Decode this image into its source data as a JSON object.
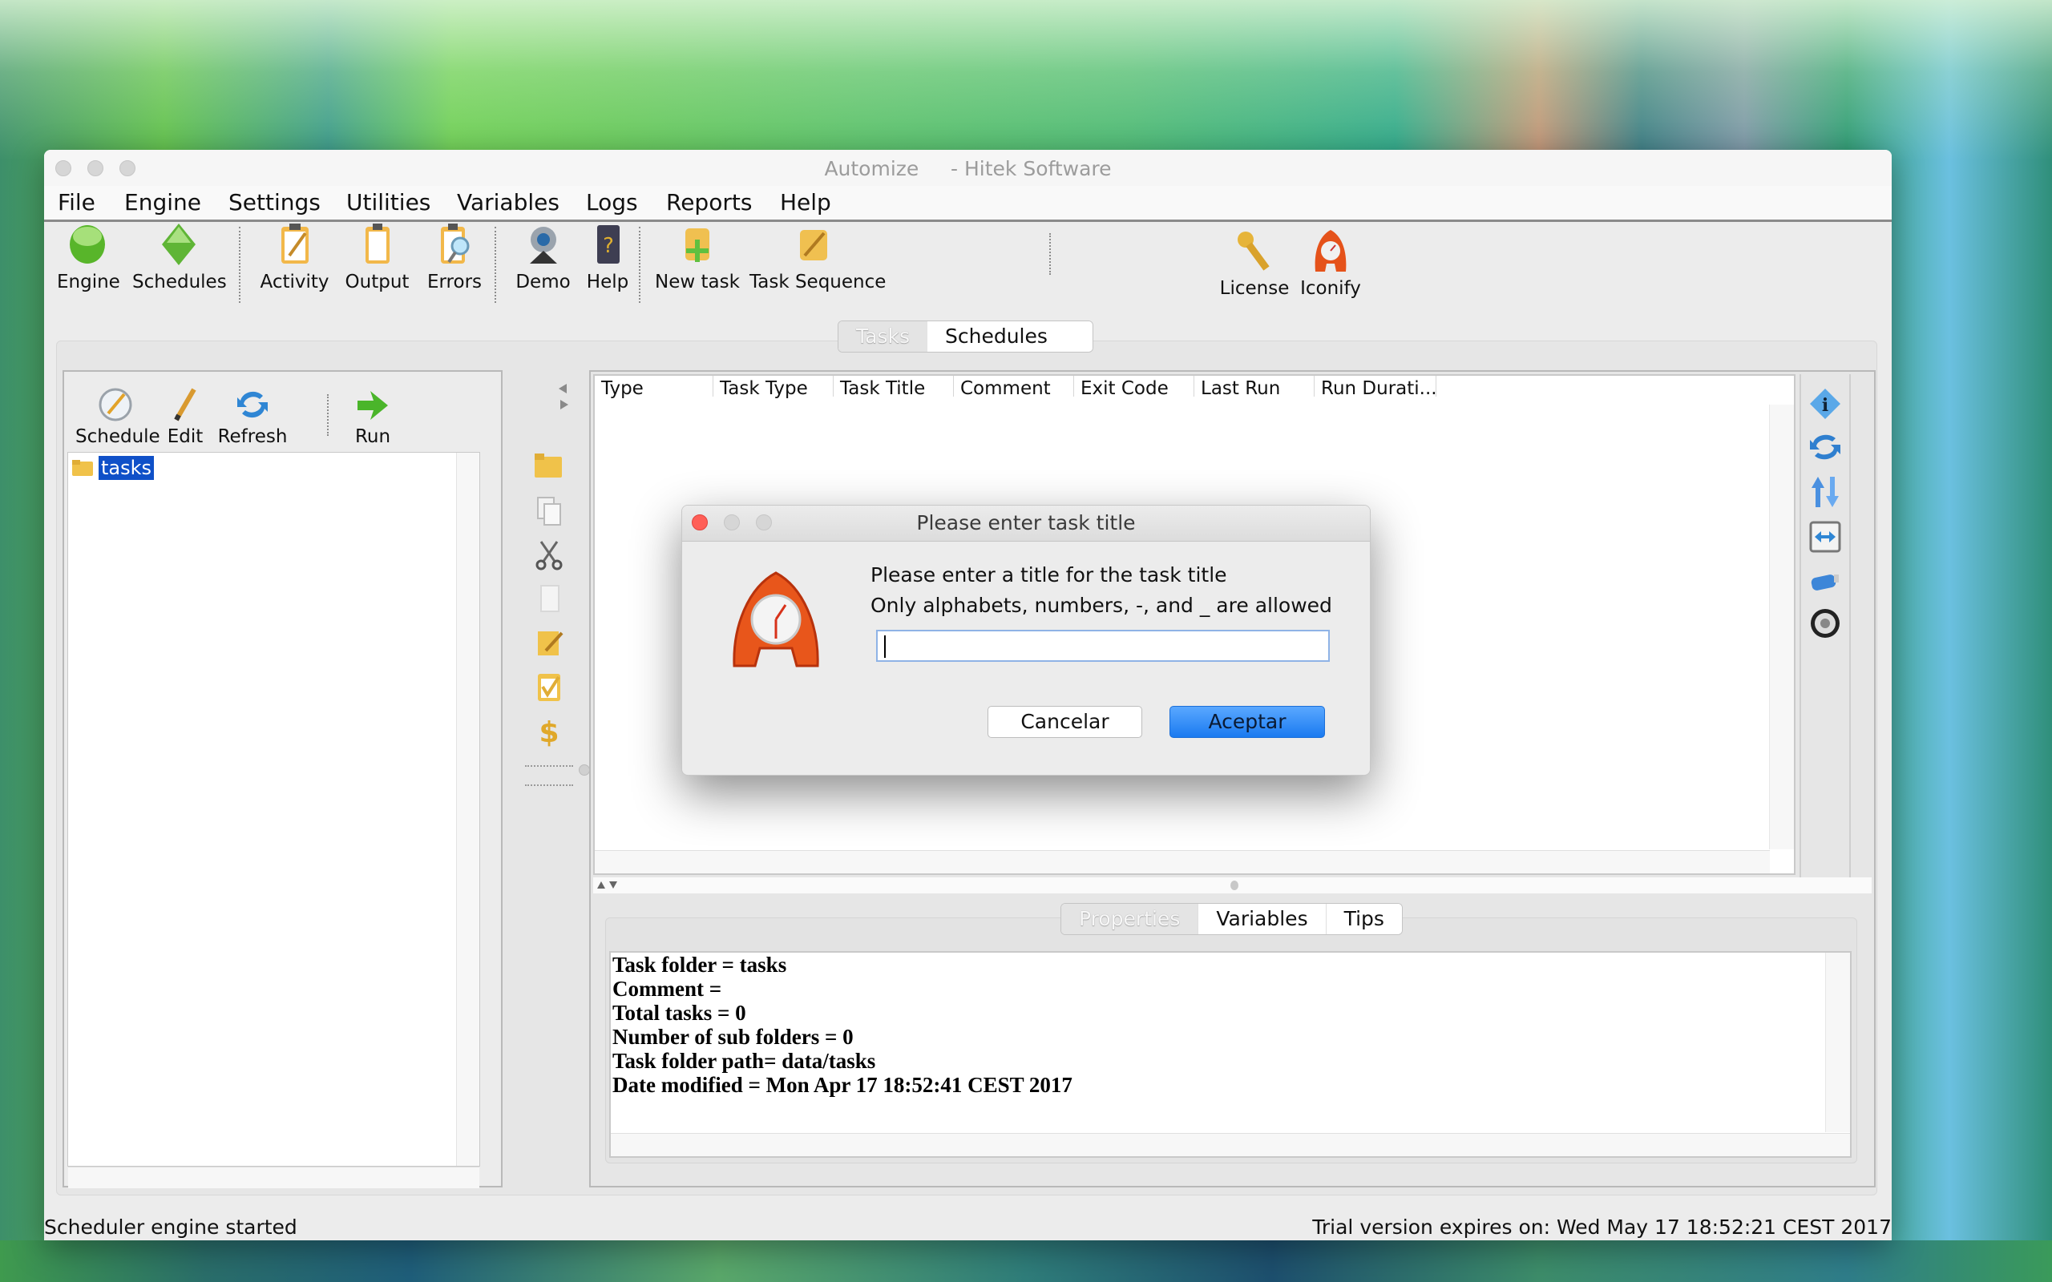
{
  "window": {
    "title": "Automize     - Hitek Software",
    "menu": [
      "File",
      "Engine",
      "Settings",
      "Utilities",
      "Variables",
      "Logs",
      "Reports",
      "Help"
    ],
    "toolbar": [
      {
        "label": "Engine",
        "icon": "engine-green-oval-icon"
      },
      {
        "label": "Schedules",
        "icon": "schedules-green-diamond-icon"
      },
      {
        "label": "Activity",
        "icon": "activity-clipboard-icon"
      },
      {
        "label": "Output",
        "icon": "output-clipboard-icon"
      },
      {
        "label": "Errors",
        "icon": "errors-magnifier-icon"
      },
      {
        "label": "Demo",
        "icon": "webcam-icon"
      },
      {
        "label": "Help",
        "icon": "help-book-icon"
      },
      {
        "label": "New task",
        "icon": "new-task-scroll-icon"
      },
      {
        "label": "Task Sequence",
        "icon": "task-sequence-scroll-icon"
      },
      {
        "label": "License",
        "icon": "key-icon"
      },
      {
        "label": "Iconify",
        "icon": "alarm-clock-icon"
      }
    ],
    "main_tabs": [
      {
        "label": "Tasks",
        "selected": true
      },
      {
        "label": "Schedules",
        "selected": false
      }
    ]
  },
  "left_panel": {
    "toolbar": [
      {
        "label": "Schedule",
        "icon": "schedule-clock-icon"
      },
      {
        "label": "Edit",
        "icon": "pencil-icon"
      },
      {
        "label": "Refresh",
        "icon": "refresh-icon"
      },
      {
        "label": "Run",
        "icon": "run-arrow-icon"
      }
    ],
    "tree": [
      {
        "label": "tasks",
        "selected": true,
        "icon": "folder-icon"
      }
    ]
  },
  "middle_icons": [
    "open-folder-icon",
    "copy-icon",
    "cut-scissors-icon",
    "paste-icon",
    "edit-note-icon",
    "checklist-icon",
    "dollar-variable-icon"
  ],
  "table": {
    "columns": [
      "Type",
      "Task Type",
      "Task Title",
      "Comment",
      "Exit Code",
      "Last Run",
      "Run Durati..."
    ],
    "rows": []
  },
  "right_icons": [
    "info-icon",
    "sync-icon",
    "sort-up-down-icon",
    "fit-width-icon",
    "usb-drive-icon",
    "disk-icon"
  ],
  "properties": {
    "tabs": [
      {
        "label": "Properties",
        "selected": true
      },
      {
        "label": "Variables",
        "selected": false
      },
      {
        "label": "Tips",
        "selected": false
      }
    ],
    "lines": [
      "Task folder = tasks",
      "Comment =",
      "Total tasks = 0",
      "Number of sub folders = 0",
      "Task folder path= data/tasks",
      "Date modified = Mon Apr 17 18:52:41 CEST 2017"
    ]
  },
  "status": {
    "left": "Scheduler engine started",
    "right": "Trial version expires on: Wed May 17 18:52:21 CEST 2017"
  },
  "dialog": {
    "title": "Please enter task title",
    "message_line1": "Please enter a title for the task title",
    "message_line2": "Only alphabets, numbers, -, and _ are allowed",
    "input_value": "",
    "cancel_label": "Cancelar",
    "ok_label": "Aceptar",
    "accent_color": "#1a7af0",
    "close_color": "#ff5f57"
  }
}
